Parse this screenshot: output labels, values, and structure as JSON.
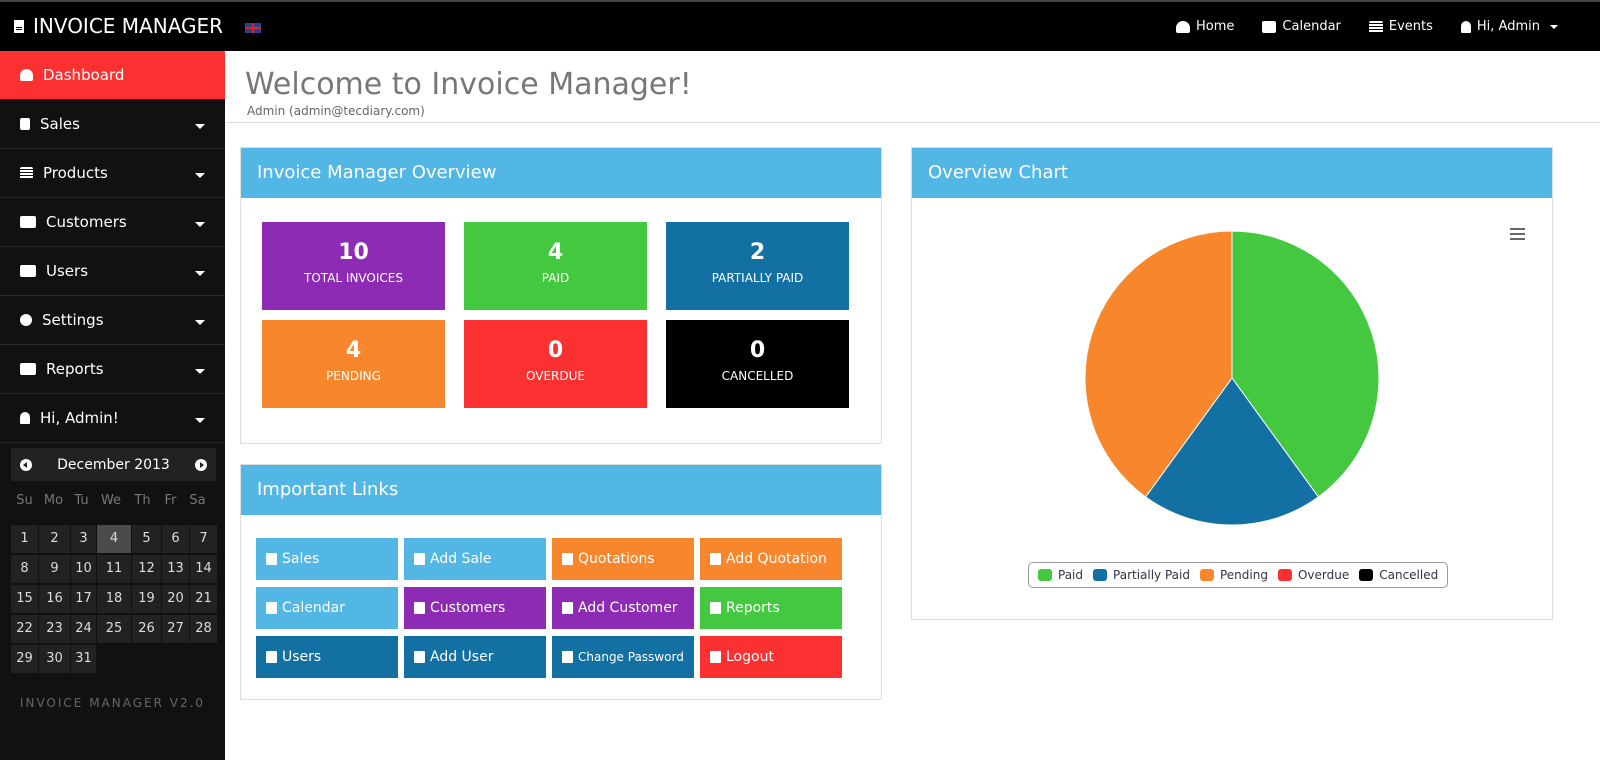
{
  "app": {
    "title": "INVOICE MANAGER",
    "flag": "uk-flag-icon"
  },
  "topnav": {
    "items": [
      {
        "label": "Home",
        "icon": "dashboard-icon"
      },
      {
        "label": "Calendar",
        "icon": "calendar-icon"
      },
      {
        "label": "Events",
        "icon": "list-icon"
      },
      {
        "label": "Hi, Admin",
        "icon": "user-icon"
      }
    ]
  },
  "sidebar": {
    "items": [
      {
        "label": "Dashboard",
        "icon": "dashboard-icon",
        "active": true
      },
      {
        "label": "Sales",
        "icon": "file-icon"
      },
      {
        "label": "Products",
        "icon": "list-icon"
      },
      {
        "label": "Customers",
        "icon": "users-icon"
      },
      {
        "label": "Users",
        "icon": "users-icon"
      },
      {
        "label": "Settings",
        "icon": "gear-icon"
      },
      {
        "label": "Reports",
        "icon": "bar-chart-icon"
      },
      {
        "label": "Hi, Admin!",
        "icon": "user-icon"
      }
    ],
    "calendar": {
      "month": "December 2013",
      "dow": [
        "Su",
        "Mo",
        "Tu",
        "We",
        "Th",
        "Fr",
        "Sa"
      ],
      "days": [
        "1",
        "2",
        "3",
        "4",
        "5",
        "6",
        "7",
        "8",
        "9",
        "10",
        "11",
        "12",
        "13",
        "14",
        "15",
        "16",
        "17",
        "18",
        "19",
        "20",
        "21",
        "22",
        "23",
        "24",
        "25",
        "26",
        "27",
        "28",
        "29",
        "30",
        "31"
      ],
      "today": "4"
    },
    "version": "INVOICE MANAGER V2.0"
  },
  "header": {
    "welcome": "Welcome to Invoice Manager!",
    "user": "Admin (admin@tecdiary.com)"
  },
  "overview": {
    "title": "Invoice Manager Overview",
    "tiles": [
      {
        "value": "10",
        "label": "TOTAL INVOICES",
        "color": "#8e2bb5"
      },
      {
        "value": "4",
        "label": "PAID",
        "color": "#44c83f"
      },
      {
        "value": "2",
        "label": "PARTIALLY PAID",
        "color": "#1370a3"
      },
      {
        "value": "4",
        "label": "PENDING",
        "color": "#f7862c"
      },
      {
        "value": "0",
        "label": "OVERDUE",
        "color": "#fb3030"
      },
      {
        "value": "0",
        "label": "CANCELLED",
        "color": "#000000"
      }
    ]
  },
  "links": {
    "title": "Important Links",
    "items": [
      {
        "label": "Sales",
        "icon": "file-icon",
        "color": "#53b7e6"
      },
      {
        "label": "Add Sale",
        "icon": "file-icon",
        "color": "#53b7e6"
      },
      {
        "label": "Quotations",
        "icon": "file-icon",
        "color": "#f7862c"
      },
      {
        "label": "Add Quotation",
        "icon": "file-icon",
        "color": "#f7862c"
      },
      {
        "label": "Calendar",
        "icon": "calendar-icon",
        "color": "#53b7e6"
      },
      {
        "label": "Customers",
        "icon": "users-icon",
        "color": "#8e2bb5"
      },
      {
        "label": "Add Customer",
        "icon": "user-icon",
        "color": "#8e2bb5"
      },
      {
        "label": "Reports",
        "icon": "bar-chart-icon",
        "color": "#44c83f"
      },
      {
        "label": "Users",
        "icon": "users-icon",
        "color": "#1370a3"
      },
      {
        "label": "Add User",
        "icon": "user-icon",
        "color": "#1370a3"
      },
      {
        "label": "Change Password",
        "icon": "key-icon",
        "color": "#1370a3"
      },
      {
        "label": "Logout",
        "icon": "logout-icon",
        "color": "#fb3030"
      }
    ]
  },
  "chart_panel": {
    "title": "Overview Chart"
  },
  "chart_data": {
    "type": "pie",
    "title": "Overview Chart",
    "categories": [
      "Paid",
      "Partially Paid",
      "Pending",
      "Overdue",
      "Cancelled"
    ],
    "values": [
      4,
      2,
      4,
      0,
      0
    ],
    "colors": [
      "#44c83f",
      "#1370a3",
      "#f7862c",
      "#fb3030",
      "#000000"
    ],
    "legend": "bottom"
  }
}
